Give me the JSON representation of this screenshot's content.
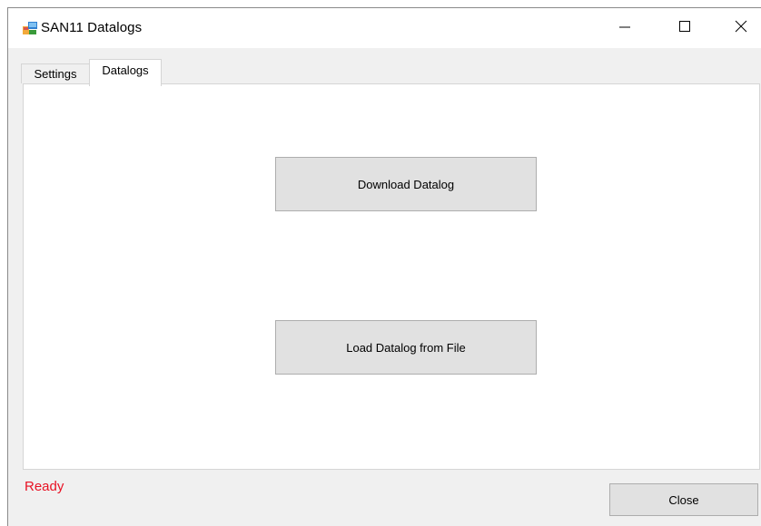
{
  "window": {
    "title": "SAN11 Datalogs",
    "icon": "app-icon"
  },
  "titlebar_controls": {
    "minimize_icon": "minimize-icon",
    "maximize_icon": "maximize-icon",
    "close_icon": "close-icon"
  },
  "tabs": [
    {
      "label": "Settings",
      "selected": false
    },
    {
      "label": "Datalogs",
      "selected": true
    }
  ],
  "panel": {
    "download_button": "Download Datalog",
    "load_button": "Load Datalog from File"
  },
  "footer": {
    "status": "Ready",
    "status_color": "#e81123",
    "close_button": "Close"
  }
}
